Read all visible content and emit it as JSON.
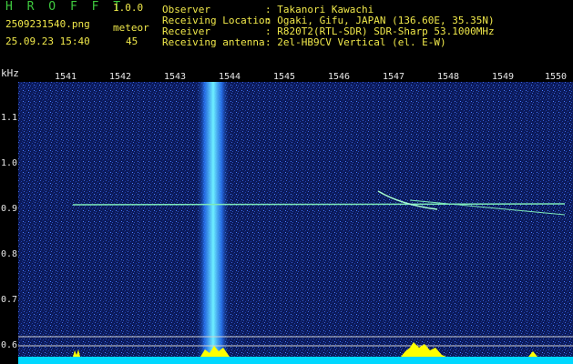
{
  "header": {
    "app_title": "H R O F F T",
    "app_version": "1.0.0",
    "file_name": "2509231540.png",
    "detect_label": "meteor",
    "timestamp": "25.09.23 15:40",
    "detect_count": "45"
  },
  "meta": [
    {
      "label": "Observer",
      "value": ": Takanori Kawachi"
    },
    {
      "label": "Receiving Location",
      "value": ": Ogaki, Gifu, JAPAN (136.60E, 35.35N)"
    },
    {
      "label": "Receiver",
      "value": ": R820T2(RTL-SDR) SDR-Sharp 53.1000MHz"
    },
    {
      "label": "Receiving antenna",
      "value": ": 2el-HB9CV Vertical (el. E-W)"
    }
  ],
  "colors": {
    "background": "#000000",
    "header_green": "#3ec83e",
    "header_yellow": "#f0e84a",
    "noise_blue": "#1f3fae",
    "band_cyan": "#6ef0ff",
    "spectrum_yellow": "#ffff00"
  },
  "axis": {
    "y_unit": "kHz",
    "x_ticks": [
      "1541",
      "1542",
      "1543",
      "1544",
      "1545",
      "1546",
      "1547",
      "1548",
      "1549",
      "1550"
    ],
    "y_ticks": [
      "1.1",
      "1.0",
      "0.9",
      "0.8",
      "0.7",
      "0.6"
    ]
  }
}
